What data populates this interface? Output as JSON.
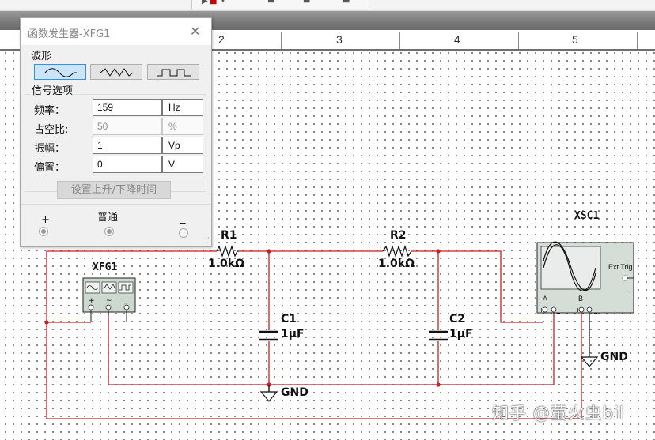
{
  "ruler": {
    "numbers": [
      "2",
      "3",
      "4",
      "5"
    ]
  },
  "dialog": {
    "title": "函数发生器-XFG1",
    "close_icon": "close-icon",
    "waveform_label": "波形",
    "waveforms": [
      "sine-wave-icon",
      "triangle-wave-icon",
      "square-wave-icon"
    ],
    "selected_waveform": "sine",
    "signal_options_label": "信号选项",
    "fields": {
      "frequency": {
        "label": "频率：",
        "value": "159",
        "unit": "Hz"
      },
      "duty_cycle": {
        "label": "占空比:",
        "value": "50",
        "unit": "%"
      },
      "amplitude": {
        "label": "振幅：",
        "value": "1",
        "unit": "Vp"
      },
      "offset": {
        "label": "偏置：",
        "value": "0",
        "unit": "V"
      }
    },
    "rise_fall_button": "设置上升/下降时间",
    "terminals": {
      "plus": "+",
      "common": "普通",
      "minus": "_"
    }
  },
  "schematic": {
    "xfg_label": "XFG1",
    "xsc_label": "XSC1",
    "r1": {
      "name": "R1",
      "value": "1.0kΩ"
    },
    "r2": {
      "name": "R2",
      "value": "1.0kΩ"
    },
    "c1": {
      "name": "C1",
      "value": "1µF"
    },
    "c2": {
      "name": "C2",
      "value": "1µF"
    },
    "gnd1": "GND",
    "gnd2": "GND",
    "ext_trig": "Ext Trig",
    "channel_a": "A",
    "channel_b": "B",
    "wire_color": "#cc1f1f"
  },
  "watermark": "知乎 @萤火虫bil"
}
